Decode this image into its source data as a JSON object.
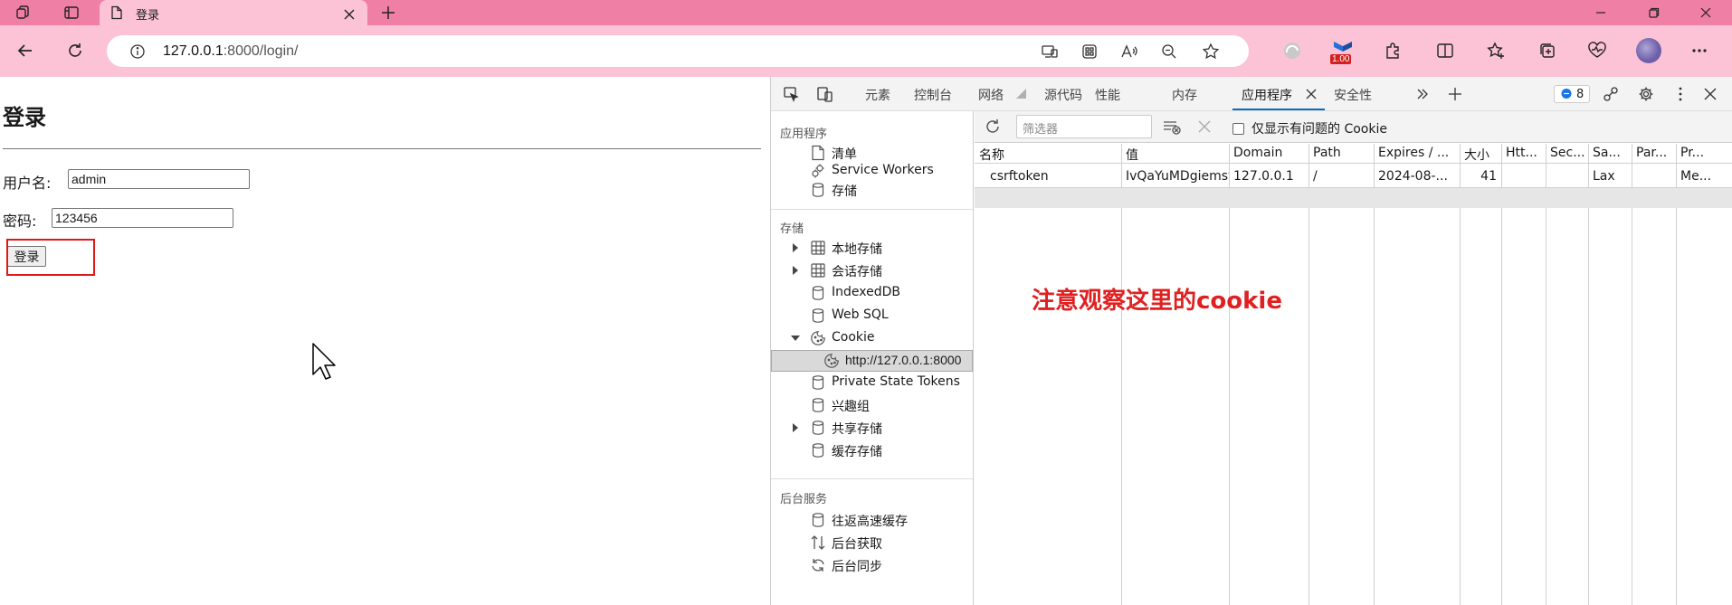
{
  "browser": {
    "tab": {
      "title": "登录"
    },
    "url": {
      "host": "127.0.0.1",
      "path": ":8000/login/"
    },
    "reading_badge": "1.00",
    "accent": "#f07fa6",
    "toolbar_bg": "#fbc3d5"
  },
  "page": {
    "heading": "登录",
    "username_label": "用户名:",
    "username_value": "admin",
    "password_label": "密码:",
    "password_value": "123456",
    "submit_label": "登录"
  },
  "devtools": {
    "tabs": [
      "元素",
      "控制台",
      "网络",
      "源代码",
      "性能",
      "内存",
      "应用程序",
      "安全性"
    ],
    "active_tab": "应用程序",
    "issue_count": "8",
    "sidebar": {
      "app_header": "应用程序",
      "app_items": [
        "清单",
        "Service Workers",
        "存储"
      ],
      "storage_header": "存储",
      "storage_items": [
        "本地存储",
        "会话存储",
        "IndexedDB",
        "Web SQL",
        "Cookie",
        "http://127.0.0.1:8000",
        "Private State Tokens",
        "兴趣组",
        "共享存储",
        "缓存存储"
      ],
      "bg_header": "后台服务",
      "bg_items": [
        "往返高速缓存",
        "后台获取",
        "后台同步"
      ]
    },
    "filter_placeholder": "筛选器",
    "only_issues_label": "仅显示有问题的 Cookie",
    "columns": [
      "名称",
      "值",
      "Domain",
      "Path",
      "Expires / ...",
      "大小",
      "Htt...",
      "Sec...",
      "Sa...",
      "Par...",
      "Pr..."
    ],
    "rows": [
      [
        "csrftoken",
        "IvQaYuMDgiemsw...",
        "127.0.0.1",
        "/",
        "2024-08-...",
        "41",
        "",
        "",
        "Lax",
        "",
        "Me..."
      ]
    ],
    "annotation": "注意观察这里的cookie"
  }
}
